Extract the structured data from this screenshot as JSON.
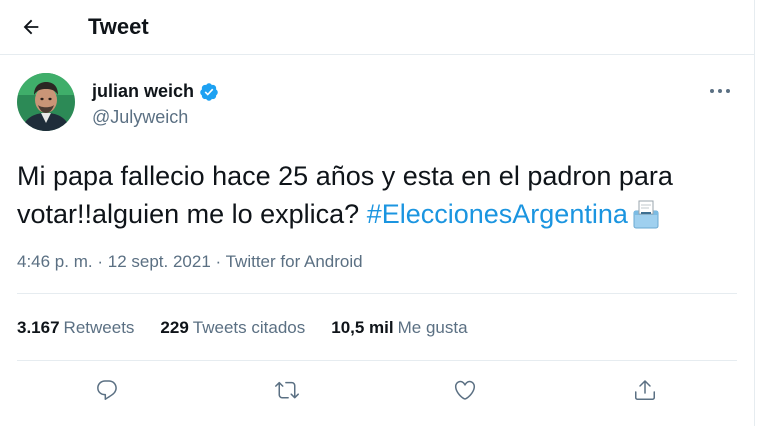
{
  "header": {
    "title": "Tweet",
    "back_icon": "arrow-left-icon"
  },
  "tweet": {
    "author": {
      "name": "julian weich",
      "handle": "@Julyweich",
      "verified": true
    },
    "text_plain": "Mi papa fallecio hace 25 años y esta en el padron para votar!!alguien me lo explica? ",
    "hashtag": "#EleccionesArgentina",
    "emoji": "ballot-box-icon",
    "time": "4:46 p. m.",
    "date": "12 sept. 2021",
    "source": "Twitter for Android",
    "separator": "·"
  },
  "stats": {
    "retweets_count": "3.167",
    "retweets_label": "Retweets",
    "quotes_count": "229",
    "quotes_label": "Tweets citados",
    "likes_count": "10,5 mil",
    "likes_label": "Me gusta"
  },
  "actions": [
    "reply-icon",
    "retweet-icon",
    "like-icon",
    "share-icon"
  ],
  "colors": {
    "accent": "#1b95e0",
    "verified": "#1da1f2",
    "secondary_text": "#5b7083",
    "border": "#e6ecf0"
  }
}
